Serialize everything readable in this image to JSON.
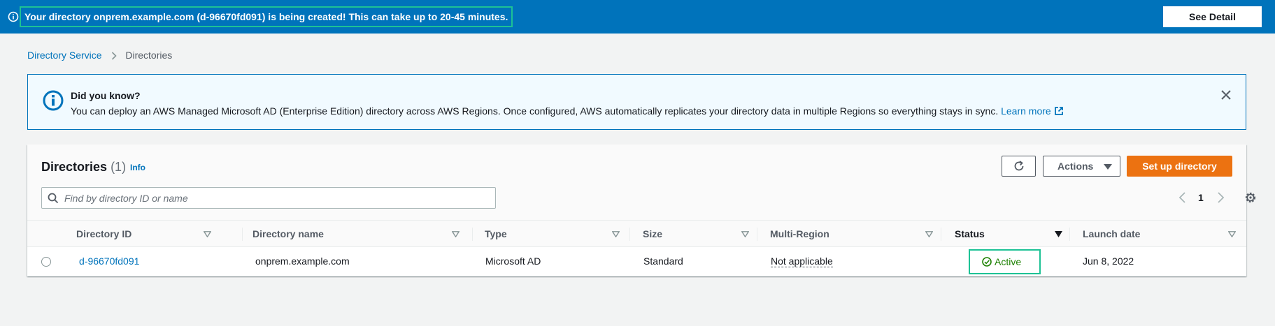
{
  "flash": {
    "message": "Your directory onprem.example.com (d-96670fd091) is being created! This can take up to 20-45 minutes.",
    "see_detail_label": "See Detail"
  },
  "breadcrumb": {
    "root": "Directory Service",
    "current": "Directories"
  },
  "info_alert": {
    "title": "Did you know?",
    "text": "You can deploy an AWS Managed Microsoft AD (Enterprise Edition) directory across AWS Regions. Once configured, AWS automatically replicates your directory data in multiple Regions so everything stays in sync.",
    "link_label": "Learn more"
  },
  "directories": {
    "title": "Directories",
    "count": "(1)",
    "info_label": "Info",
    "actions_label": "Actions",
    "primary_label": "Set up directory",
    "search_placeholder": "Find by directory ID or name",
    "page": "1",
    "columns": [
      "Directory ID",
      "Directory name",
      "Type",
      "Size",
      "Multi-Region",
      "Status",
      "Launch date"
    ],
    "rows": [
      {
        "id": "d-96670fd091",
        "name": "onprem.example.com",
        "type": "Microsoft AD",
        "size": "Standard",
        "multi_region": "Not applicable",
        "status": "Active",
        "launch_date": "Jun 8, 2022"
      }
    ]
  },
  "colors": {
    "flash_bg": "#0073bb",
    "highlight": "#1dc295",
    "primary": "#ec7211",
    "success": "#1d8102"
  }
}
